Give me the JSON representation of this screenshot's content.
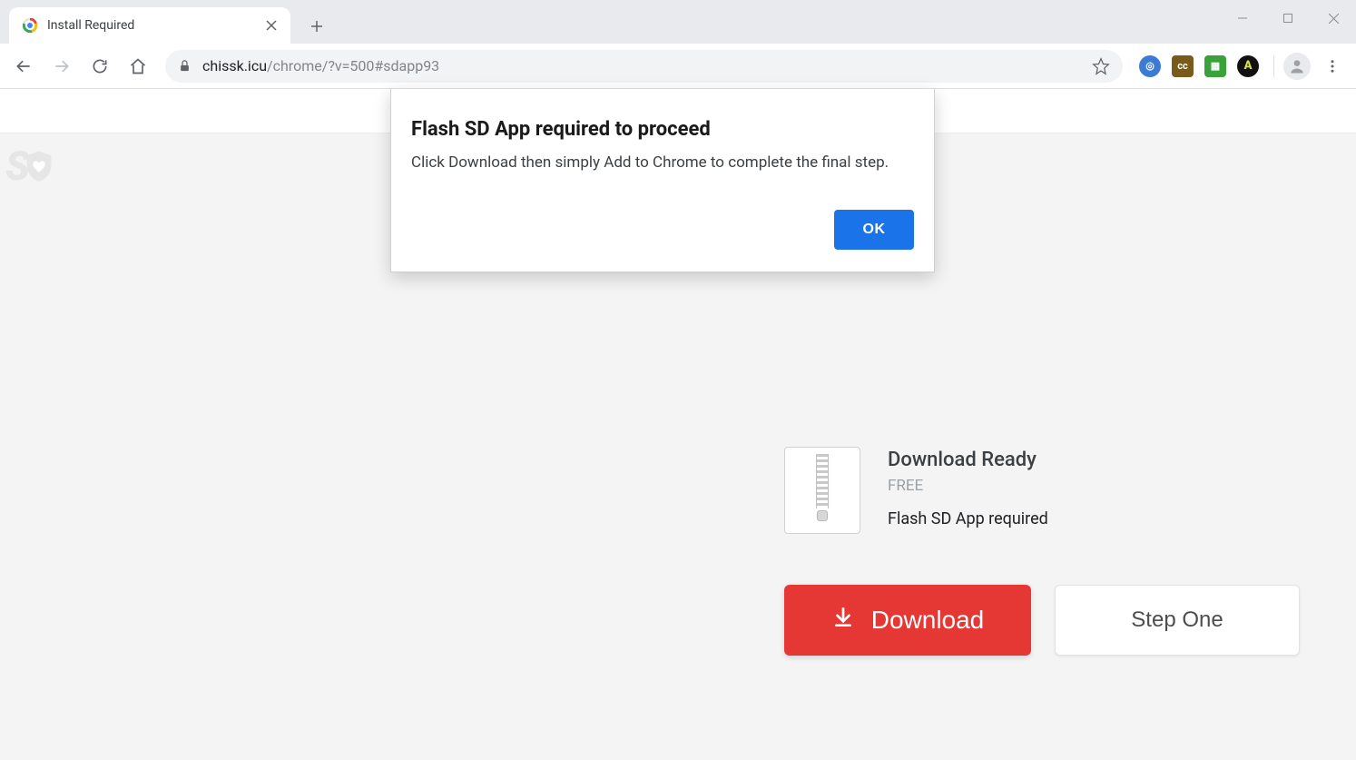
{
  "window": {
    "tab_title": "Install Required"
  },
  "address": {
    "domain": "chissk.icu",
    "path": "/chrome/?v=500#sdapp93"
  },
  "dialog": {
    "title": "Flash SD App required to proceed",
    "message": "Click Download then simply Add to Chrome to complete the final step.",
    "ok_label": "OK"
  },
  "download": {
    "title": "Download Ready",
    "free_label": "FREE",
    "requirement": "Flash SD App required",
    "download_label": "Download",
    "step_label": "Step One"
  },
  "logo": {
    "text": "SD"
  },
  "extensions": [
    {
      "name": "ext-blue-swirl",
      "bg": "#3b7bd6",
      "glyph": "◎"
    },
    {
      "name": "ext-cc",
      "bg": "#7a5a1a",
      "glyph": "cc"
    },
    {
      "name": "ext-green",
      "bg": "#3aa23a",
      "glyph": "▦"
    },
    {
      "name": "ext-a",
      "bg": "#111111",
      "glyph": "A"
    }
  ]
}
